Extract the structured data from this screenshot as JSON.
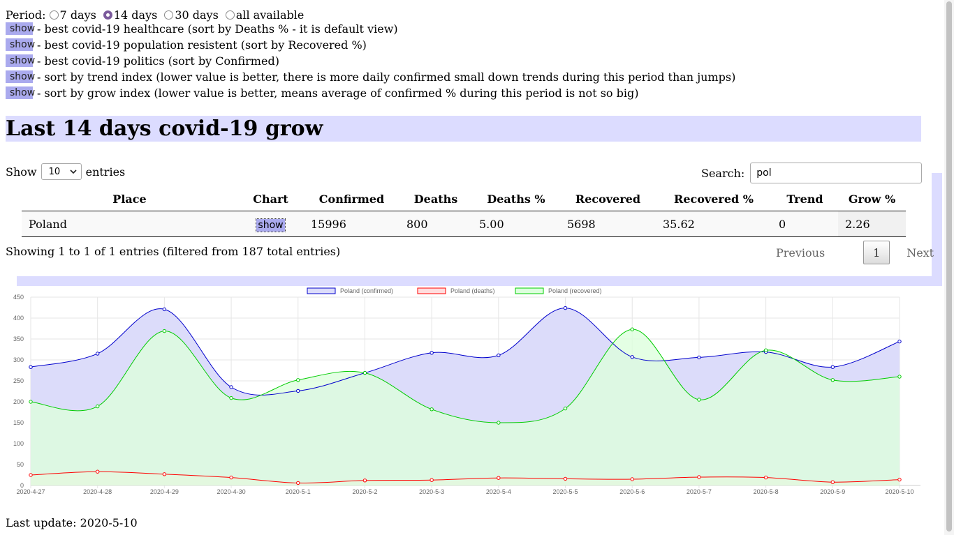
{
  "period": {
    "label": "Period:",
    "options": [
      {
        "label": "7 days",
        "checked": false
      },
      {
        "label": "14 days",
        "checked": true
      },
      {
        "label": "30 days",
        "checked": false
      },
      {
        "label": "all available",
        "checked": false
      }
    ]
  },
  "views": [
    {
      "button": "show",
      "text": "- best covid-19 healthcare (sort by Deaths % - it is default view)"
    },
    {
      "button": "show",
      "text": "- best covid-19 population resistent (sort by Recovered %)"
    },
    {
      "button": "show",
      "text": "- best covid-19 politics (sort by Confirmed)"
    },
    {
      "button": "show",
      "text": "- sort by trend index (lower value is better, there is more daily confirmed small down trends during this period than jumps)"
    },
    {
      "button": "show",
      "text": "- sort by grow index (lower value is better, means average of confirmed % during this period is not so big)"
    }
  ],
  "title": "Last 14 days covid-19 grow",
  "table": {
    "length_prefix": "Show",
    "length_value": "10",
    "length_suffix": "entries",
    "search_label": "Search:",
    "search_value": "pol",
    "headers": [
      "Place",
      "Chart",
      "Confirmed",
      "Deaths",
      "Deaths %",
      "Recovered",
      "Recovered %",
      "Trend",
      "Grow %"
    ],
    "rows": [
      {
        "place": "Poland",
        "chart": "show",
        "confirmed": "15996",
        "deaths": "800",
        "deaths_pct": "5.00",
        "recovered": "5698",
        "recovered_pct": "35.62",
        "trend": "0",
        "grow_pct": "2.26"
      }
    ],
    "info": "Showing 1 to 1 of 1 entries (filtered from 187 total entries)",
    "pager": {
      "previous": "Previous",
      "page": "1",
      "next": "Next"
    }
  },
  "chart_data": {
    "type": "line",
    "x": [
      "2020-4-27",
      "2020-4-28",
      "2020-4-29",
      "2020-4-30",
      "2020-5-1",
      "2020-5-2",
      "2020-5-3",
      "2020-5-4",
      "2020-5-5",
      "2020-5-6",
      "2020-5-7",
      "2020-5-8",
      "2020-5-9",
      "2020-5-10"
    ],
    "ylim": [
      0,
      450
    ],
    "yticks": [
      0,
      50,
      100,
      150,
      200,
      250,
      300,
      350,
      400,
      450
    ],
    "series": [
      {
        "name": "Poland (confirmed)",
        "color": "#0000cc",
        "fill": "#dcdcfa",
        "values": [
          283,
          315,
          421,
          235,
          226,
          269,
          317,
          311,
          424,
          307,
          306,
          319,
          283,
          344
        ]
      },
      {
        "name": "Poland (deaths)",
        "color": "#ff0000",
        "fill": "#ffdddd",
        "values": [
          25,
          33,
          27,
          19,
          6,
          12,
          13,
          18,
          16,
          15,
          20,
          19,
          8,
          14
        ]
      },
      {
        "name": "Poland (recovered)",
        "color": "#00cc00",
        "fill": "#ddffdd",
        "values": [
          200,
          189,
          369,
          209,
          252,
          269,
          182,
          150,
          184,
          373,
          205,
          323,
          252,
          260
        ]
      }
    ],
    "grid": true,
    "legend": "top"
  },
  "footer": "Last update: 2020-5-10"
}
